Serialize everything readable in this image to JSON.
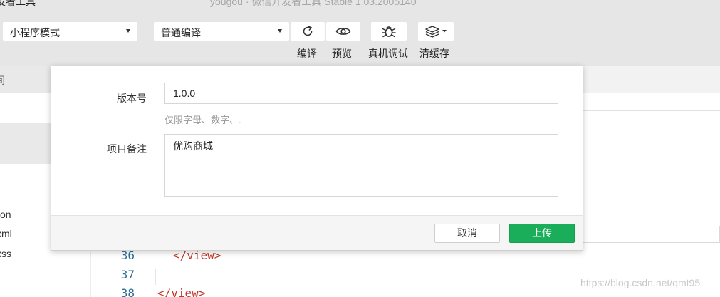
{
  "window": {
    "title": "发者工具",
    "title_suffix": "yougou · 微信开发者工具 Stable 1.03.2005140"
  },
  "toolbar": {
    "mode_select": {
      "value": "小程序模式"
    },
    "compile_select": {
      "value": "普通编译"
    },
    "compile": {
      "label": "编译",
      "icon": "refresh-icon"
    },
    "preview": {
      "label": "预览",
      "icon": "eye-icon"
    },
    "debug": {
      "label": "真机调试",
      "icon": "bug-icon"
    },
    "cache": {
      "label": "清缓存",
      "icon": "layers-icon"
    }
  },
  "left_panel": {
    "partial_char": "间",
    "files": [
      "on",
      "xml",
      "xss"
    ]
  },
  "editor": {
    "lines": [
      {
        "number": "36",
        "code": "</view>"
      },
      {
        "number": "37",
        "code": ""
      },
      {
        "number": "38",
        "code": "</view>"
      }
    ]
  },
  "dialog": {
    "version_label": "版本号",
    "version_value": "1.0.0",
    "version_hint": "仅限字母、数字、.",
    "note_label": "项目备注",
    "note_value": "优购商城",
    "cancel_label": "取消",
    "upload_label": "上传"
  },
  "watermark": "https://blog.csdn.net/qmt95",
  "colors": {
    "toolbar_bg": "#e6e6e6",
    "primary_green": "#1aad5a",
    "line_number": "#2a6f97",
    "tag": "#c0392b"
  }
}
